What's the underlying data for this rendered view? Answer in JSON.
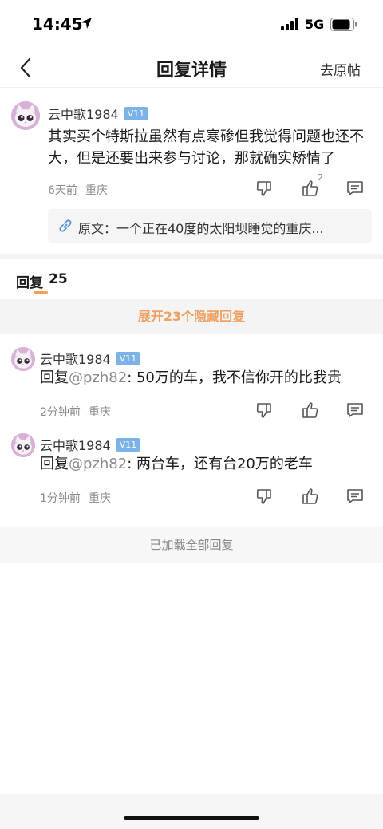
{
  "status": {
    "time": "14:45",
    "network": "5G"
  },
  "nav": {
    "title": "回复详情",
    "link": "去原帖"
  },
  "main_comment": {
    "user": "云中歌1984",
    "level": "V11",
    "text": "其实买个特斯拉虽然有点寒碜但我觉得问题也还不大，但是还要出来参与讨论，那就确实矫情了",
    "time": "6天前",
    "location": "重庆",
    "like_count": "2",
    "source": "原文：一个正在40度的太阳坝睡觉的重庆..."
  },
  "replies": {
    "label": "回复",
    "count": "25",
    "expand": "展开23个隐藏回复",
    "items": [
      {
        "user": "云中歌1984",
        "level": "V11",
        "prefix": "回复",
        "mention": "@pzh82",
        "text": ": 50万的车，我不信你开的比我贵",
        "time": "2分钟前",
        "location": "重庆"
      },
      {
        "user": "云中歌1984",
        "level": "V11",
        "prefix": "回复",
        "mention": "@pzh82",
        "text": ": 两台车，还有台20万的老车",
        "time": "1分钟前",
        "location": "重庆"
      }
    ],
    "loaded": "已加载全部回复"
  },
  "colors": {
    "accent": "#f0a062",
    "badge": "#7bb3e8",
    "avatar": "#d8b2d6"
  },
  "icons": [
    "location-arrow-icon",
    "signal-icon",
    "battery-icon",
    "back-chevron-icon",
    "dislike-icon",
    "like-icon",
    "comment-icon",
    "link-icon",
    "cat-avatar-icon"
  ]
}
